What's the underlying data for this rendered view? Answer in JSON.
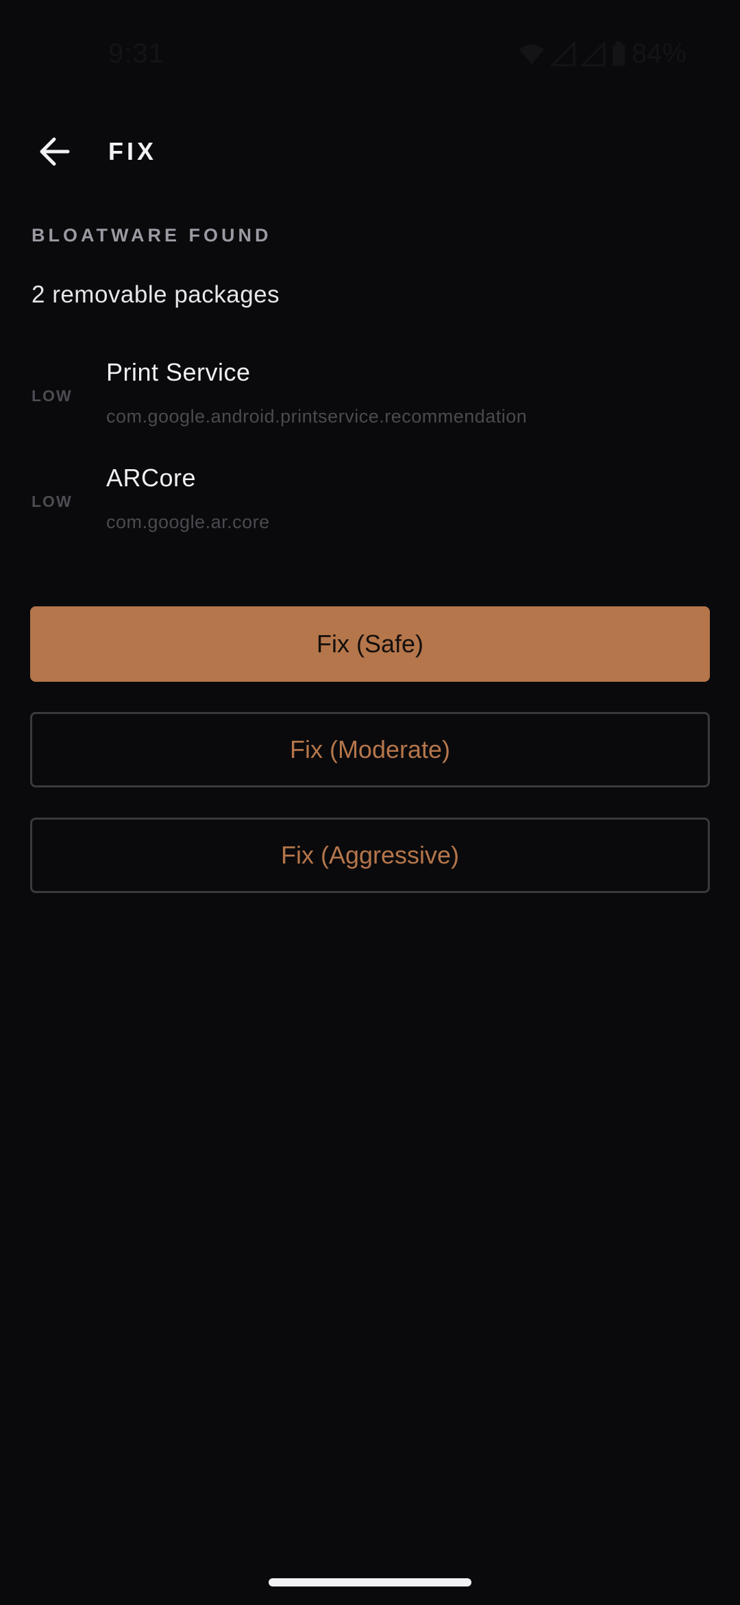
{
  "status_bar": {
    "time": "9:31",
    "battery": "84%",
    "icons": [
      "wifi-icon",
      "signal-icon",
      "signal-icon",
      "battery-icon"
    ]
  },
  "app_bar": {
    "back_icon": "arrow-left-icon",
    "title": "FIX"
  },
  "section": {
    "header": "BLOATWARE FOUND",
    "summary": "2 removable packages"
  },
  "packages": [
    {
      "risk": "LOW",
      "name": "Print Service",
      "id": "com.google.android.printservice.recommendation"
    },
    {
      "risk": "LOW",
      "name": "ARCore",
      "id": "com.google.ar.core"
    }
  ],
  "actions": {
    "safe_label": "Fix (Safe)",
    "moderate_label": "Fix (Moderate)",
    "aggressive_label": "Fix (Aggressive)"
  },
  "colors": {
    "background": "#0a0a0c",
    "accent": "#b5764b",
    "outline": "#3a3a3e"
  }
}
